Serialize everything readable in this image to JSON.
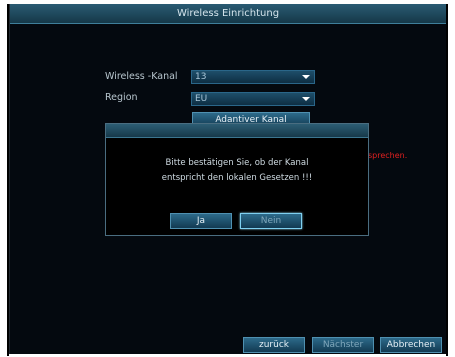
{
  "window": {
    "title": "Wireless Einrichtung"
  },
  "form": {
    "channel_label": "Wireless -Kanal",
    "channel_value": "13",
    "region_label": "Region",
    "region_value": "EU",
    "adaptive_button": "Adantiver Kanal",
    "partial_warning": "sprechen."
  },
  "dialog": {
    "message_line1": "Bitte bestätigen Sie, ob der Kanal",
    "message_line2": "entspricht den lokalen Gesetzen !!!",
    "yes_label": "Ja",
    "no_label": "Nein"
  },
  "footer": {
    "back_label": "zurück",
    "next_label": "Nächster",
    "cancel_label": "Abbrechen"
  },
  "colors": {
    "background": "#04090f",
    "titlebar": "#2a5b73",
    "button": "#2d6a8a",
    "warning": "#e02020"
  }
}
